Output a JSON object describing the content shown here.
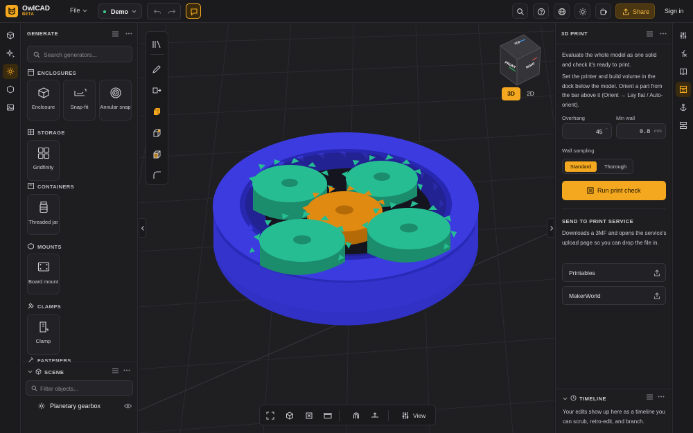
{
  "app": {
    "name": "OwlCAD",
    "badge": "BETA"
  },
  "topbar": {
    "file_menu": "File",
    "project": "Demo",
    "share": "Share",
    "sign_in": "Sign in"
  },
  "left_panel": {
    "title": "GENERATE",
    "search_placeholder": "Search generators...",
    "sections": [
      {
        "title": "ENCLOSURES",
        "items": [
          "Enclosure",
          "Snap-fit",
          "Annular snap"
        ]
      },
      {
        "title": "STORAGE",
        "items": [
          "Gridfinity"
        ]
      },
      {
        "title": "CONTAINERS",
        "items": [
          "Threaded jar"
        ]
      },
      {
        "title": "MOUNTS",
        "items": [
          "Board mount"
        ]
      },
      {
        "title": "CLAMPS",
        "items": [
          "Clamp"
        ]
      },
      {
        "title": "FASTENERS",
        "items": []
      }
    ],
    "scene": {
      "title": "SCENE",
      "filter_placeholder": "Filter objects...",
      "items": [
        "Planetary gearbox"
      ]
    }
  },
  "viewport": {
    "view_modes": [
      "3D",
      "2D"
    ],
    "active_mode": "3D",
    "bottom_view_label": "View",
    "view_cube": {
      "top": "TOP",
      "front": "FRONT",
      "right": "RIGHT"
    }
  },
  "right_panel": {
    "title": "3D PRINT",
    "intro": "Evaluate the whole model as one solid and check it's ready to print.",
    "instructions": "Set the printer and build volume in the dock below the model. Orient a part from the bar above it (Orient → Lay flat / Auto-orient).",
    "overhang": {
      "label": "Overhang",
      "value": "45",
      "unit": "°"
    },
    "min_wall": {
      "label": "Min wall",
      "value": "0.8",
      "unit": "mm"
    },
    "wall_sampling": {
      "label": "Wall sampling",
      "options": [
        "Standard",
        "Thorough"
      ],
      "selected": "Standard"
    },
    "run_button": "Run print check",
    "send_section": {
      "title": "SEND TO PRINT SERVICE",
      "description": "Downloads a 3MF and opens the service's upload page so you can drop the file in.",
      "services": [
        "Printables",
        "MakerWorld"
      ]
    },
    "timeline": {
      "title": "TIMELINE",
      "description": "Your edits show up here as a timeline you can scrub, retro-edit, and branch."
    }
  },
  "colors": {
    "accent": "#f3a81f",
    "ring": "#3a3ad0",
    "planet_gear": "#23b08a",
    "sun_gear": "#e08a12"
  }
}
